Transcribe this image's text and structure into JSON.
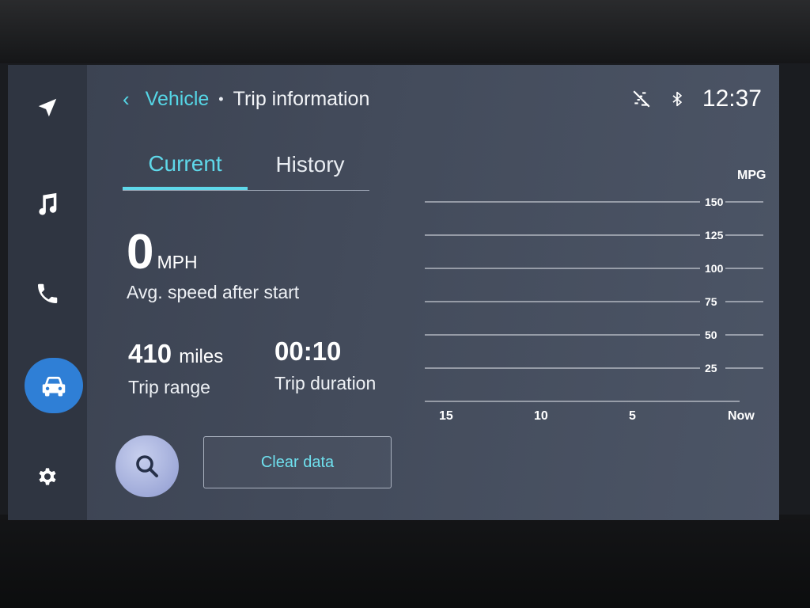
{
  "header": {
    "back_label": "‹",
    "breadcrumb_parent": "Vehicle",
    "breadcrumb_separator": "•",
    "breadcrumb_current": "Trip information"
  },
  "status": {
    "clock": "12:37",
    "icons": [
      "no-signal-icon",
      "bluetooth-icon"
    ]
  },
  "rail": {
    "items": [
      {
        "icon": "navigation-icon"
      },
      {
        "icon": "music-icon"
      },
      {
        "icon": "phone-icon"
      },
      {
        "icon": "car-icon",
        "active": true
      },
      {
        "icon": "gear-icon"
      }
    ],
    "accent_color": "#2f7fd6"
  },
  "tabs": [
    {
      "label": "Current",
      "selected": true
    },
    {
      "label": "History",
      "selected": false
    }
  ],
  "current": {
    "avg_speed_value": "0",
    "avg_speed_unit": "MPH",
    "avg_speed_label": "Avg. speed after start",
    "range_value": "410",
    "range_unit": "miles",
    "range_label": "Trip range",
    "duration_value": "00:10",
    "duration_label": "Trip duration"
  },
  "actions": {
    "search_icon": "search-icon",
    "clear_label": "Clear data"
  },
  "chart_data": {
    "type": "bar",
    "ylabel": "MPG",
    "yticks": [
      150,
      125,
      100,
      75,
      50,
      25
    ],
    "xticks": [
      "15",
      "10",
      "5",
      "Now"
    ],
    "series": [],
    "ylim": [
      0,
      150
    ],
    "grid": true
  },
  "colors": {
    "accent": "#5fd8ea",
    "active_nav": "#2f7fd6"
  }
}
